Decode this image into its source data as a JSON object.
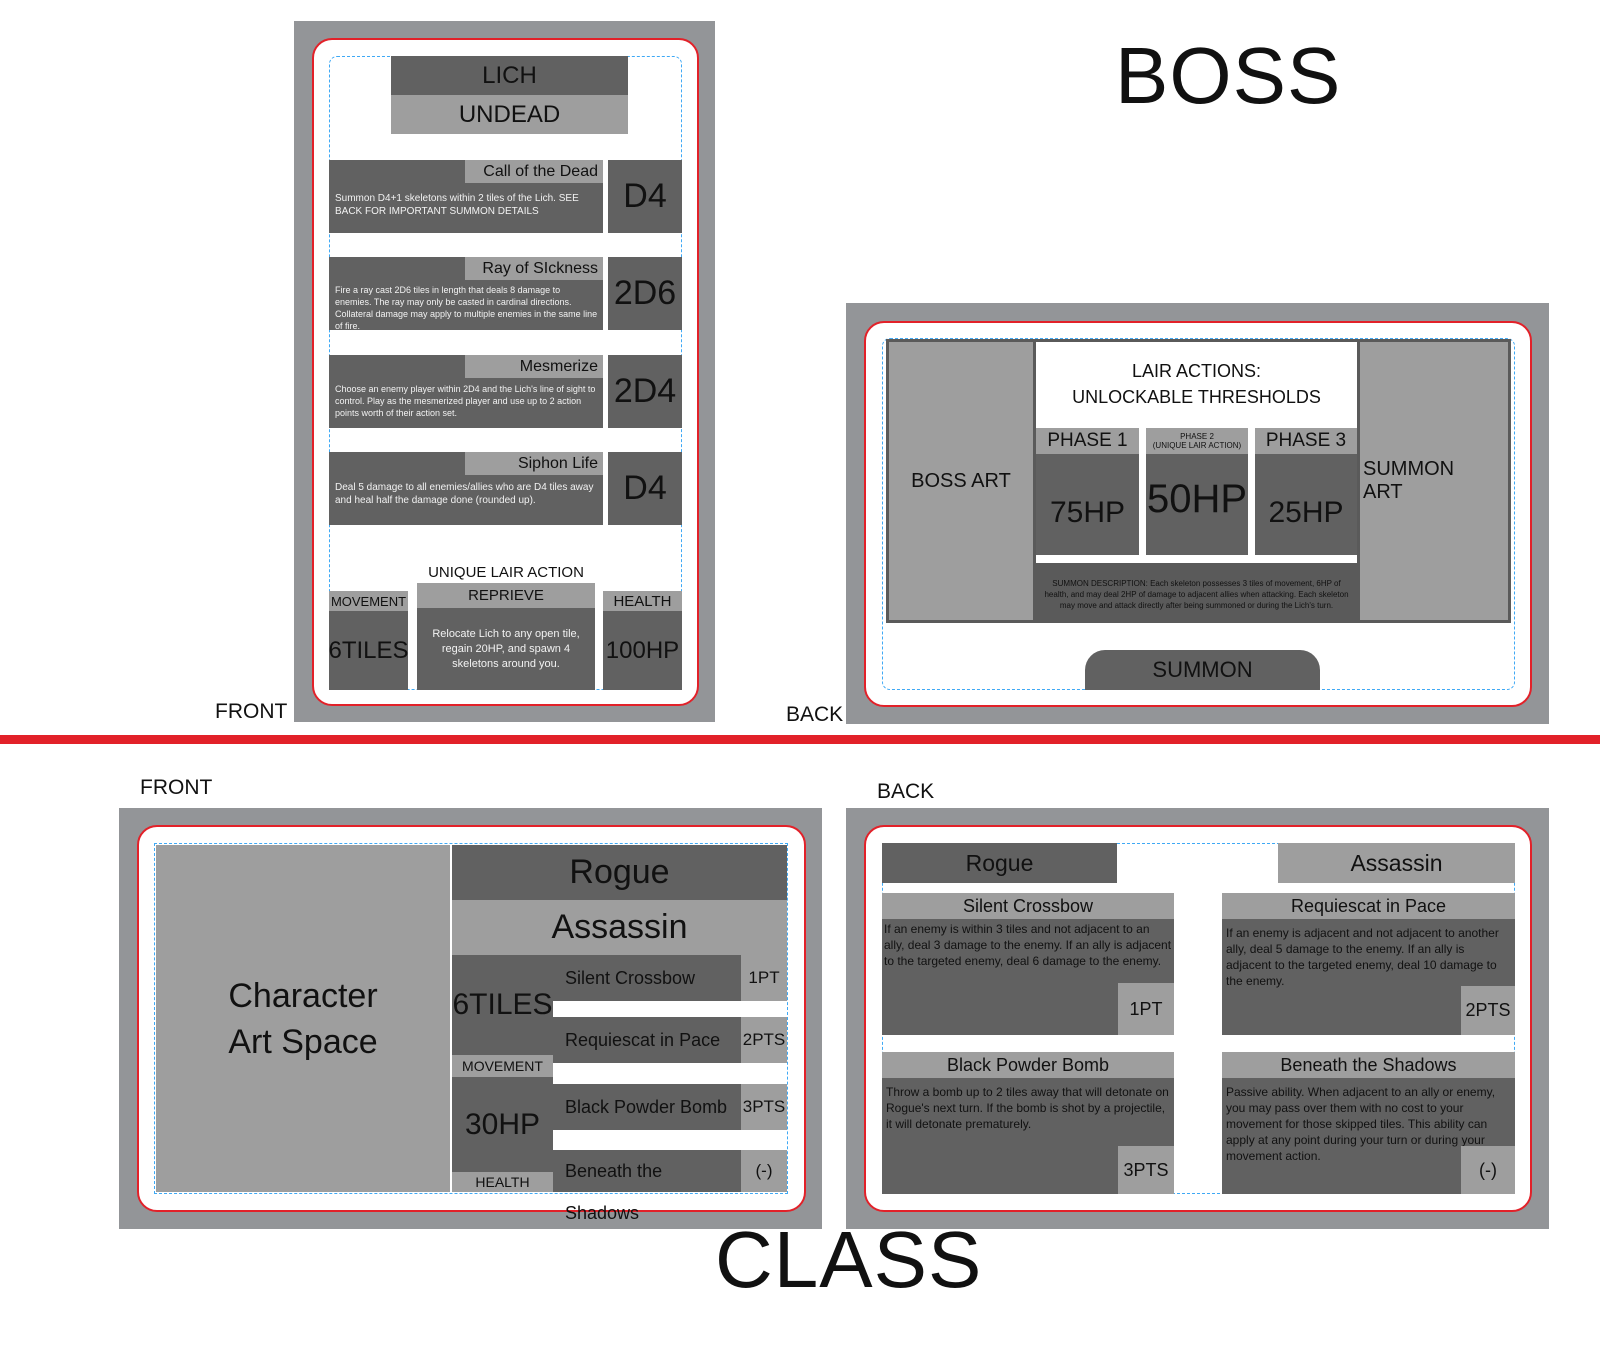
{
  "sections": {
    "boss": "BOSS",
    "class_title": "CLASS"
  },
  "labels": {
    "boss_front": "FRONT",
    "boss_back": "BACK",
    "class_front": "FRONT",
    "class_back": "BACK"
  },
  "colors": {
    "card_border": "#e22129",
    "divider": "#e22129",
    "guide": "#3fa9f5",
    "frame": "#939598",
    "dark_panel": "#616161",
    "light_panel": "#9e9e9e"
  },
  "boss_front": {
    "name": "LICH",
    "type": "UNDEAD",
    "abilities": [
      {
        "title": "Call of the Dead",
        "desc": "Summon D4+1 skeletons within 2 tiles of the Lich. SEE BACK FOR IMPORTANT SUMMON DETAILS",
        "dice": "D4"
      },
      {
        "title": "Ray of SIckness",
        "desc": "Fire a ray cast 2D6 tiles in length that deals 8 damage to enemies. The ray may only be casted in cardinal directions. Collateral damage may apply to multiple enemies in the same line of fire.",
        "dice": "2D6"
      },
      {
        "title": "Mesmerize",
        "desc": "Choose an enemy player within 2D4 and the Lich's line of sight to control. Play as the mesmerized player and use up to 2 action points worth of their action set.",
        "dice": "2D4"
      },
      {
        "title": "Siphon Life",
        "desc": "Deal 5 damage to all enemies/allies who are D4 tiles away and heal half the damage done (rounded up).",
        "dice": "D4"
      }
    ],
    "lair_heading": "UNIQUE LAIR ACTION",
    "movement_label": "MOVEMENT",
    "movement_value": "6TILES",
    "lair_title": "REPRIEVE",
    "lair_desc": "Relocate Lich to any open tile, regain 20HP, and spawn 4 skeletons around you.",
    "health_label": "HEALTH",
    "health_value": "100HP"
  },
  "boss_back": {
    "boss_art": "BOSS ART",
    "summon_art_line1": "SUMMON",
    "summon_art_line2": "ART",
    "lair_line1": "LAIR ACTIONS:",
    "lair_line2": "UNLOCKABLE THRESHOLDS",
    "phases": [
      {
        "label": "PHASE 1",
        "sub": "",
        "hp": "75HP"
      },
      {
        "label": "PHASE 2",
        "sub": "(UNIQUE LAIR ACTION)",
        "hp": "50HP"
      },
      {
        "label": "PHASE 3",
        "sub": "",
        "hp": "25HP"
      }
    ],
    "summon_desc": "SUMMON DESCRIPTION: Each skeleton possesses 3 tiles of movement, 6HP of health, and may deal 2HP of damage to adjacent allies when attacking. Each skeleton may move and attack directly after being summoned or during the Lich's turn.",
    "summon_tab": "SUMMON"
  },
  "class_front": {
    "art_line1": "Character",
    "art_line2": "Art Space",
    "class_name": "Rogue",
    "subclass": "Assassin",
    "movement_value": "6TILES",
    "movement_label": "MOVEMENT",
    "health_value": "30HP",
    "health_label": "HEALTH",
    "abilities": [
      {
        "name": "Silent Crossbow",
        "cost": "1PT"
      },
      {
        "name": "Requiescat in Pace",
        "cost": "2PTS"
      },
      {
        "name": "Black Powder Bomb",
        "cost": "3PTS"
      },
      {
        "name": "Beneath the Shadows",
        "cost": "(-)"
      }
    ]
  },
  "class_back": {
    "class_name": "Rogue",
    "subclass": "Assassin",
    "abilities": [
      {
        "title": "Silent Crossbow",
        "desc": "If an enemy is within 3 tiles and not adjacent to an ally, deal 3 damage to the enemy. If an ally is adjacent to the targeted enemy, deal 6 damage to the enemy.",
        "cost": "1PT"
      },
      {
        "title": "Requiescat in Pace",
        "desc": "If an enemy is adjacent and not adjacent to another ally, deal 5 damage to the enemy. If an ally is adjacent to the targeted enemy, deal 10 damage to the enemy.",
        "cost": "2PTS"
      },
      {
        "title": "Black Powder Bomb",
        "desc": "Throw a bomb up to 2 tiles away that will detonate on Rogue's next turn. If the bomb is shot by a projectile, it will detonate prematurely.",
        "cost": "3PTS"
      },
      {
        "title": "Beneath the Shadows",
        "desc": "Passive ability. When adjacent to an ally or enemy, you may pass over them with no cost to your movement for those skipped tiles. This ability can apply at any point during your turn or during your movement action.",
        "cost": "(-)"
      }
    ]
  }
}
